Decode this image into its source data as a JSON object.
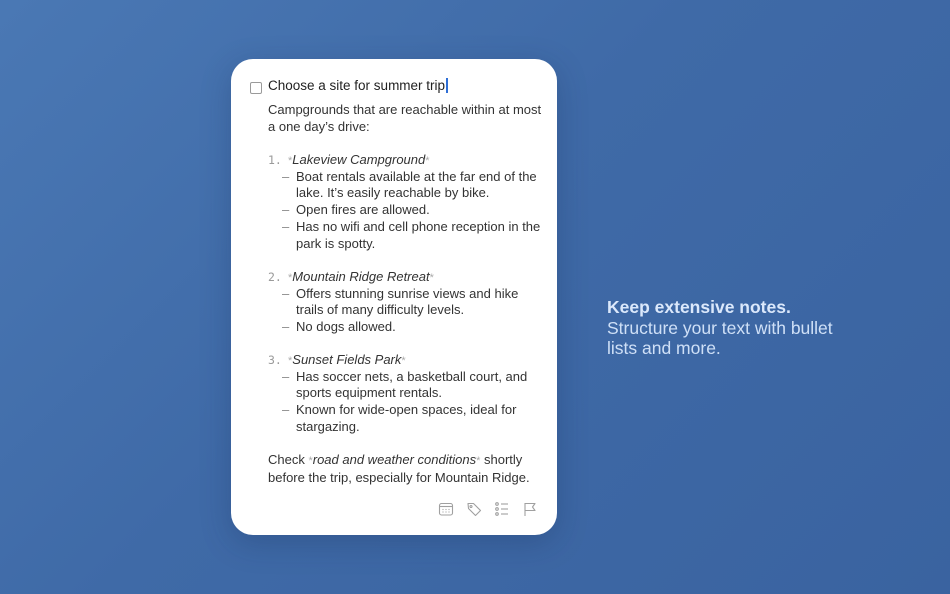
{
  "note": {
    "title": "Choose a site for summer trip",
    "intro": "Campgrounds that are reachable within at most a one day’s drive:",
    "list": [
      {
        "number": "1.",
        "heading": "Lakeview Campground",
        "items": [
          "Boat rentals available at the far end of the lake. It’s easily reachable by bike.",
          "Open fires are allowed.",
          "Has no wifi and cell phone reception in the park is spotty."
        ]
      },
      {
        "number": "2.",
        "heading": "Mountain Ridge Retreat",
        "items": [
          "Offers stunning sunrise views and hike trails of many difficulty levels.",
          "No dogs allowed."
        ]
      },
      {
        "number": "3.",
        "heading": "Sunset Fields Park",
        "items": [
          "Has soccer nets, a basketball court, and sports equipment rentals.",
          "Known for wide-open spaces, ideal for stargazing."
        ]
      }
    ],
    "outro_before": "Check ",
    "outro_emphasis": "road and weather conditions",
    "outro_after": " shortly before the trip, especially for Mountain Ridge.",
    "emphasis_marker": "*",
    "list_marker": "–"
  },
  "toolbar": {
    "icons": [
      "calendar-icon",
      "tag-icon",
      "checklist-icon",
      "flag-icon"
    ]
  },
  "promo": {
    "headline": "Keep extensive notes.",
    "subline": "Structure your text with bullet lists and more."
  },
  "colors": {
    "background": "#4470ad",
    "card": "#ffffff",
    "caret": "#2f6fd6",
    "promo_text": "#dbe8fb"
  }
}
